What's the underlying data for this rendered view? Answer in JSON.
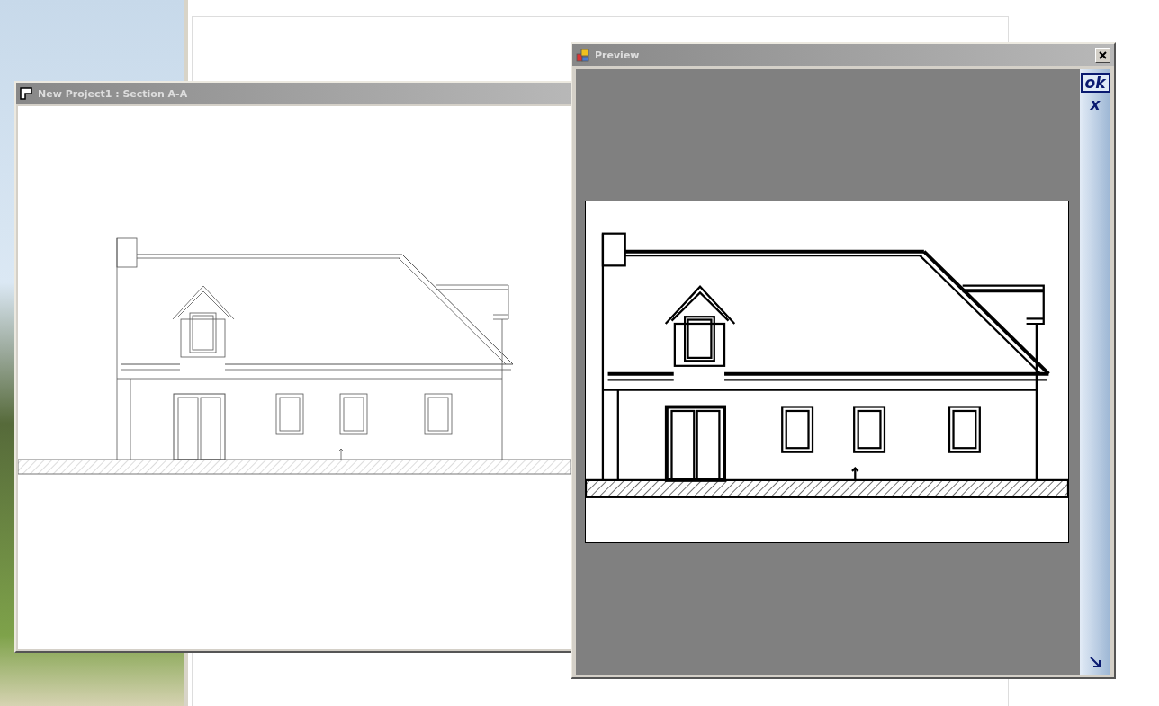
{
  "project_window": {
    "title": "New Project1 : Section A-A"
  },
  "preview_window": {
    "title": "Preview",
    "side_buttons": [
      {
        "label": "ok",
        "kind": "framed"
      },
      {
        "label": "x",
        "kind": "plain"
      }
    ]
  }
}
